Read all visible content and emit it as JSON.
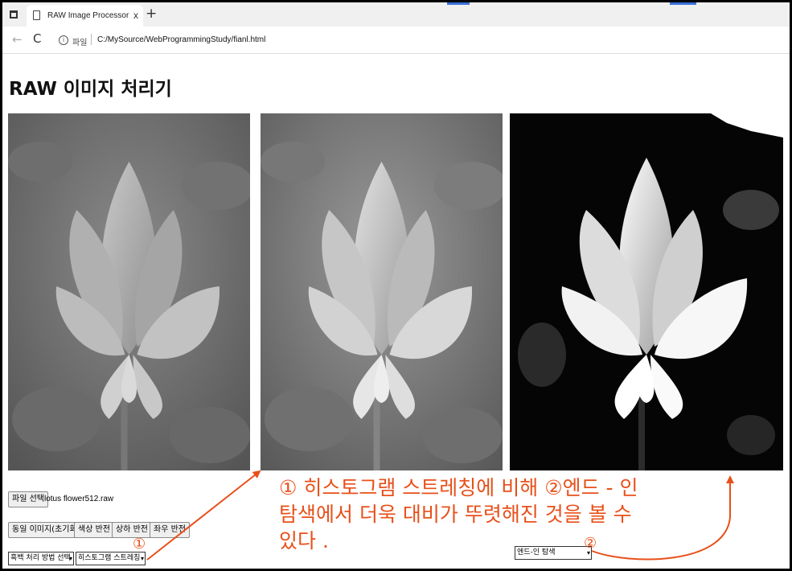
{
  "browser": {
    "tab_title": "RAW Image Processor",
    "tab_close": "x",
    "new_tab": "+",
    "back_icon": "←",
    "reload_icon": "C",
    "info_icon": "i",
    "url_scheme_label": "파일",
    "url": "C:/MySource/WebProgrammingStudy/fianl.html"
  },
  "page": {
    "title": "RAW 이미지 처리기",
    "file_button": "파일 선택",
    "file_name": "lotus flower512.raw",
    "buttons": [
      "동일 이미지(초기화)",
      "색상 반전",
      "상하 반전",
      "좌우 반전"
    ],
    "select_grayscale": "흑백 처리 방법 선택",
    "select_histogram": "히스토그램 스트레칭",
    "select_endin": "엔드-인 탐색"
  },
  "annotation": {
    "marker_1": "①",
    "marker_2": "②",
    "line1": "① 히스토그램 스트레칭에 비해 ②엔드 - 인",
    "line2": "탐색에서 더욱 대비가 뚜렷해진 것을 볼 수",
    "line3": "있다 ."
  },
  "images": [
    {
      "name": "original",
      "tone": "low-contrast"
    },
    {
      "name": "histogram-stretching",
      "tone": "brighter"
    },
    {
      "name": "end-in-search",
      "tone": "high-contrast"
    }
  ],
  "colors": {
    "annotation": "#e8501a",
    "frame": "#000000"
  }
}
